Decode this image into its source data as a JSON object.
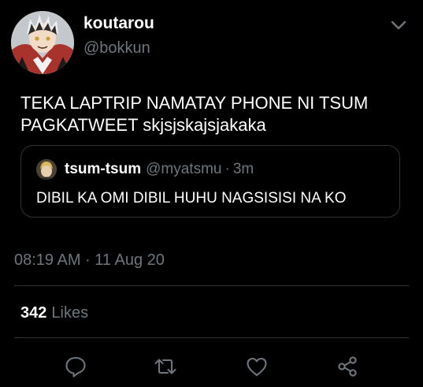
{
  "author": {
    "display_name": "koutarou",
    "handle": "@bokkun",
    "avatar_icon": "user-avatar-icon"
  },
  "tweet": {
    "text_lines": [
      "TEKA LAPTRIP NAMATAY PHONE NI TSUM",
      "PAGKATWEET skjsjskajsjakaka"
    ],
    "timestamp": "08:19 AM · 11 Aug 20"
  },
  "quoted_tweet": {
    "display_name": "tsum-tsum",
    "handle": "@myatsmu",
    "separator": "·",
    "time": "3m",
    "text": "DIBIL KA OMI DIBIL HUHU NAGSISISI NA KO",
    "avatar_icon": "quoted-user-avatar-icon"
  },
  "stats": {
    "likes_count": "342",
    "likes_label": "Likes"
  },
  "actions": {
    "reply_icon": "reply-icon",
    "retweet_icon": "retweet-icon",
    "like_icon": "like-icon",
    "share_icon": "share-icon",
    "menu_icon": "chevron-down-icon"
  },
  "colors": {
    "background": "#000000",
    "text_primary": "#ffffff",
    "text_secondary": "#6e767d",
    "border": "#2f3336",
    "icon": "#6e767d"
  }
}
